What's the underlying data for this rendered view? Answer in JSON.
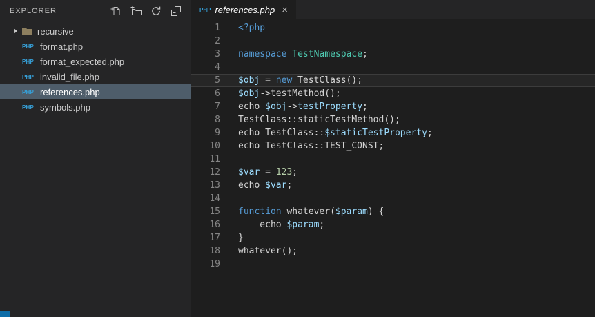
{
  "colors": {
    "editor_bg": "#1e1e1e",
    "sidebar_bg": "#252526",
    "selection_bg": "#4e5d6a",
    "accent_blue": "#0d6da8",
    "keyword": "#569cd6",
    "type": "#4ec9b0",
    "variable": "#9cdcfe",
    "number": "#b5cea8",
    "default_text": "#d4d4d4",
    "line_number": "#858585",
    "php_badge": "#369fd6"
  },
  "sidebar": {
    "title": "EXPLORER",
    "actions": [
      {
        "name": "new-file-icon"
      },
      {
        "name": "new-folder-icon"
      },
      {
        "name": "refresh-icon"
      },
      {
        "name": "collapse-all-icon"
      }
    ],
    "files": [
      {
        "label": "recursive",
        "type": "folder",
        "selected": false
      },
      {
        "label": "format.php",
        "type": "php",
        "selected": false
      },
      {
        "label": "format_expected.php",
        "type": "php",
        "selected": false
      },
      {
        "label": "invalid_file.php",
        "type": "php",
        "selected": false
      },
      {
        "label": "references.php",
        "type": "php",
        "selected": true
      },
      {
        "label": "symbols.php",
        "type": "php",
        "selected": false
      }
    ]
  },
  "tab": {
    "badge": "PHP",
    "title": "references.php",
    "close": "×"
  },
  "code": {
    "lines": [
      {
        "n": 1,
        "tokens": [
          [
            "k",
            "<?php"
          ]
        ]
      },
      {
        "n": 2,
        "tokens": []
      },
      {
        "n": 3,
        "tokens": [
          [
            "k",
            "namespace"
          ],
          [
            "d",
            " "
          ],
          [
            "t",
            "TestNamespace"
          ],
          [
            "d",
            ";"
          ]
        ]
      },
      {
        "n": 4,
        "tokens": []
      },
      {
        "n": 5,
        "hl": true,
        "tokens": [
          [
            "v",
            "$obj"
          ],
          [
            "d",
            " = "
          ],
          [
            "k",
            "new"
          ],
          [
            "d",
            " TestClass();"
          ]
        ]
      },
      {
        "n": 6,
        "tokens": [
          [
            "v",
            "$obj"
          ],
          [
            "d",
            "->testMethod();"
          ]
        ]
      },
      {
        "n": 7,
        "tokens": [
          [
            "d",
            "echo "
          ],
          [
            "v",
            "$obj"
          ],
          [
            "d",
            "->"
          ],
          [
            "v",
            "testProperty"
          ],
          [
            "d",
            ";"
          ]
        ]
      },
      {
        "n": 8,
        "tokens": [
          [
            "d",
            "TestClass::staticTestMethod();"
          ]
        ]
      },
      {
        "n": 9,
        "tokens": [
          [
            "d",
            "echo TestClass::"
          ],
          [
            "v",
            "$staticTestProperty"
          ],
          [
            "d",
            ";"
          ]
        ]
      },
      {
        "n": 10,
        "tokens": [
          [
            "d",
            "echo TestClass::TEST_CONST;"
          ]
        ]
      },
      {
        "n": 11,
        "tokens": []
      },
      {
        "n": 12,
        "tokens": [
          [
            "v",
            "$var"
          ],
          [
            "d",
            " = "
          ],
          [
            "n",
            "123"
          ],
          [
            "d",
            ";"
          ]
        ]
      },
      {
        "n": 13,
        "tokens": [
          [
            "d",
            "echo "
          ],
          [
            "v",
            "$var"
          ],
          [
            "d",
            ";"
          ]
        ]
      },
      {
        "n": 14,
        "tokens": []
      },
      {
        "n": 15,
        "tokens": [
          [
            "k",
            "function"
          ],
          [
            "d",
            " whatever("
          ],
          [
            "v",
            "$param"
          ],
          [
            "d",
            ") {"
          ]
        ]
      },
      {
        "n": 16,
        "tokens": [
          [
            "d",
            "    echo "
          ],
          [
            "v",
            "$param"
          ],
          [
            "d",
            ";"
          ]
        ]
      },
      {
        "n": 17,
        "tokens": [
          [
            "d",
            "}"
          ]
        ]
      },
      {
        "n": 18,
        "tokens": [
          [
            "d",
            "whatever();"
          ]
        ]
      },
      {
        "n": 19,
        "tokens": []
      }
    ]
  }
}
